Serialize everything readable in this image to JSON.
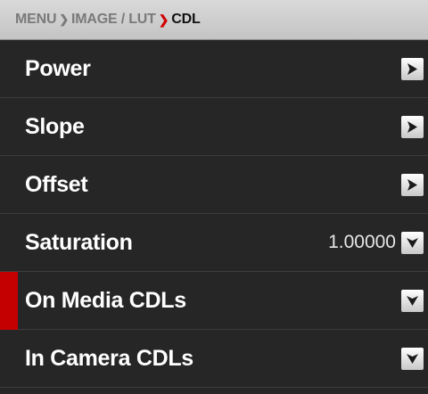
{
  "breadcrumb": {
    "items": [
      "MENU",
      "IMAGE / LUT",
      "CDL"
    ]
  },
  "menu": {
    "rows": [
      {
        "label": "Power",
        "value": "",
        "control": "arrow-right"
      },
      {
        "label": "Slope",
        "value": "",
        "control": "arrow-right"
      },
      {
        "label": "Offset",
        "value": "",
        "control": "arrow-right"
      },
      {
        "label": "Saturation",
        "value": "1.00000",
        "control": "chevron-down"
      },
      {
        "label": "On Media CDLs",
        "value": "",
        "control": "chevron-down",
        "selected": true
      },
      {
        "label": "In Camera CDLs",
        "value": "",
        "control": "chevron-down"
      }
    ]
  },
  "colors": {
    "accent": "#c40000",
    "background": "#262626",
    "breadcrumb_bg": "#cfcfcf"
  }
}
